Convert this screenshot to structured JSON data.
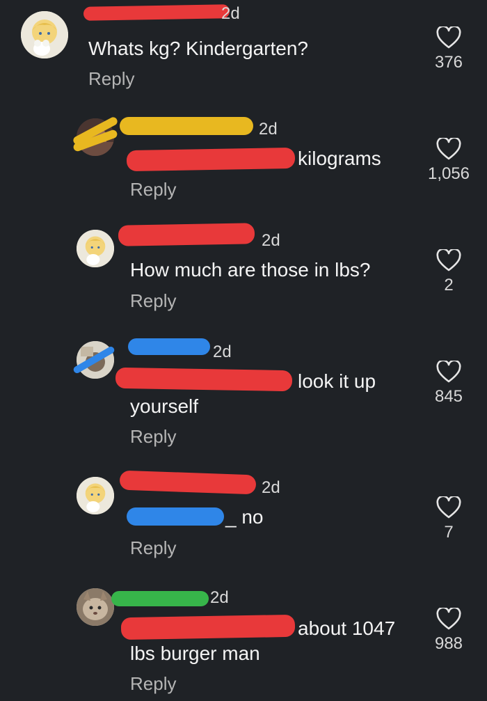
{
  "colors": {
    "background": "#1f2226",
    "redact_red": "#e8393a",
    "redact_yellow": "#e8b820",
    "redact_blue": "#2f86e8",
    "redact_green": "#37b54a"
  },
  "comments": [
    {
      "time": "2d",
      "text": "Whats kg? Kindergarten?",
      "reply": "Reply",
      "likes": "376",
      "like_icon": "heart-outline-icon",
      "avatar": "anime-avatar"
    },
    {
      "time": "2d",
      "text": "kilograms",
      "reply": "Reply",
      "likes": "1,056",
      "like_icon": "heart-outline-icon",
      "avatar": "photo-avatar"
    },
    {
      "time": "2d",
      "text": "How much are those in lbs?",
      "reply": "Reply",
      "likes": "2",
      "like_icon": "heart-outline-icon",
      "avatar": "anime-avatar"
    },
    {
      "time": "2d",
      "text_line1": "look it up",
      "text_line2": "yourself",
      "reply": "Reply",
      "likes": "845",
      "like_icon": "heart-outline-icon",
      "avatar": "photo-avatar"
    },
    {
      "time": "2d",
      "text": "_ no",
      "reply": "Reply",
      "likes": "7",
      "like_icon": "heart-outline-icon",
      "avatar": "anime-avatar"
    },
    {
      "time": "2d",
      "text_line1": "about 1047",
      "text_line2": "lbs burger man",
      "reply": "Reply",
      "likes": "988",
      "like_icon": "heart-outline-icon",
      "avatar": "cat-avatar"
    }
  ]
}
